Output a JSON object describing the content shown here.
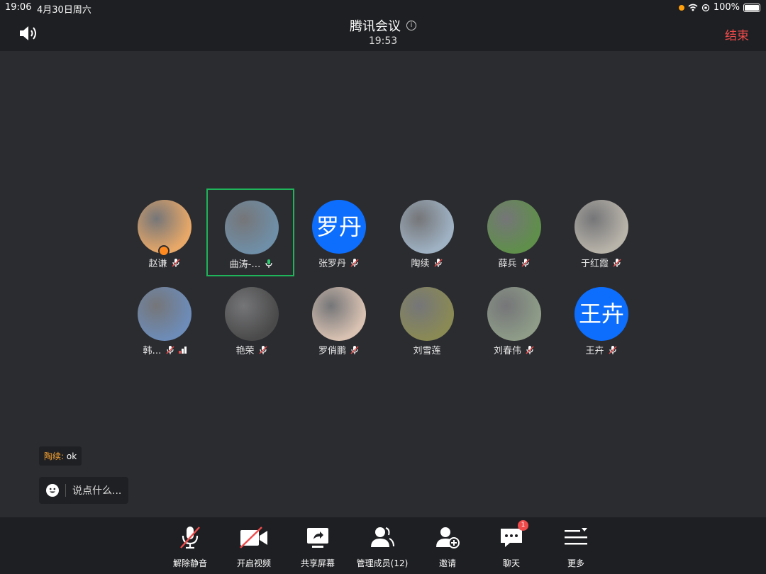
{
  "status_bar": {
    "time": "19:06",
    "date": "4月30日周六",
    "battery": "100%"
  },
  "header": {
    "title": "腾讯会议",
    "timer": "19:53",
    "end_label": "结束"
  },
  "participants": [
    {
      "name": "赵谦",
      "avatar_text": "",
      "avatar_color": "#e8a868",
      "muted": true,
      "host": true
    },
    {
      "name": "曲涛-…",
      "avatar_text": "",
      "avatar_color": "#6f8fa8",
      "muted": false,
      "speaking": true
    },
    {
      "name": "张罗丹",
      "avatar_text": "罗丹",
      "avatar_color": "#0d6efd",
      "muted": true
    },
    {
      "name": "陶续",
      "avatar_text": "",
      "avatar_color": "#9fb2c4",
      "muted": true
    },
    {
      "name": "薛兵",
      "avatar_text": "",
      "avatar_color": "#5f8f4a",
      "muted": true
    },
    {
      "name": "于红霞",
      "avatar_text": "",
      "avatar_color": "#b9b4aa",
      "muted": true
    },
    {
      "name": "韩…",
      "avatar_text": "",
      "avatar_color": "#6d8cb8",
      "muted": true,
      "signal": true
    },
    {
      "name": "艳荣",
      "avatar_text": "",
      "avatar_color": "#4a4a4a",
      "muted": true
    },
    {
      "name": "罗俏鹏",
      "avatar_text": "",
      "avatar_color": "#d9c2b2",
      "muted": true
    },
    {
      "name": "刘雪莲",
      "avatar_text": "",
      "avatar_color": "#8a8a55",
      "muted": false
    },
    {
      "name": "刘春伟",
      "avatar_text": "",
      "avatar_color": "#8e9c88",
      "muted": true
    },
    {
      "name": "王卉",
      "avatar_text": "王卉",
      "avatar_color": "#0d6efd",
      "muted": true
    }
  ],
  "chat": {
    "sender": "陶续:",
    "message": "ok",
    "input_placeholder": "说点什么..."
  },
  "toolbar": {
    "unmute": "解除静音",
    "video": "开启视频",
    "share": "共享屏幕",
    "members": "管理成员(12)",
    "invite": "邀请",
    "chat": "聊天",
    "chat_badge": "1",
    "more": "更多"
  }
}
